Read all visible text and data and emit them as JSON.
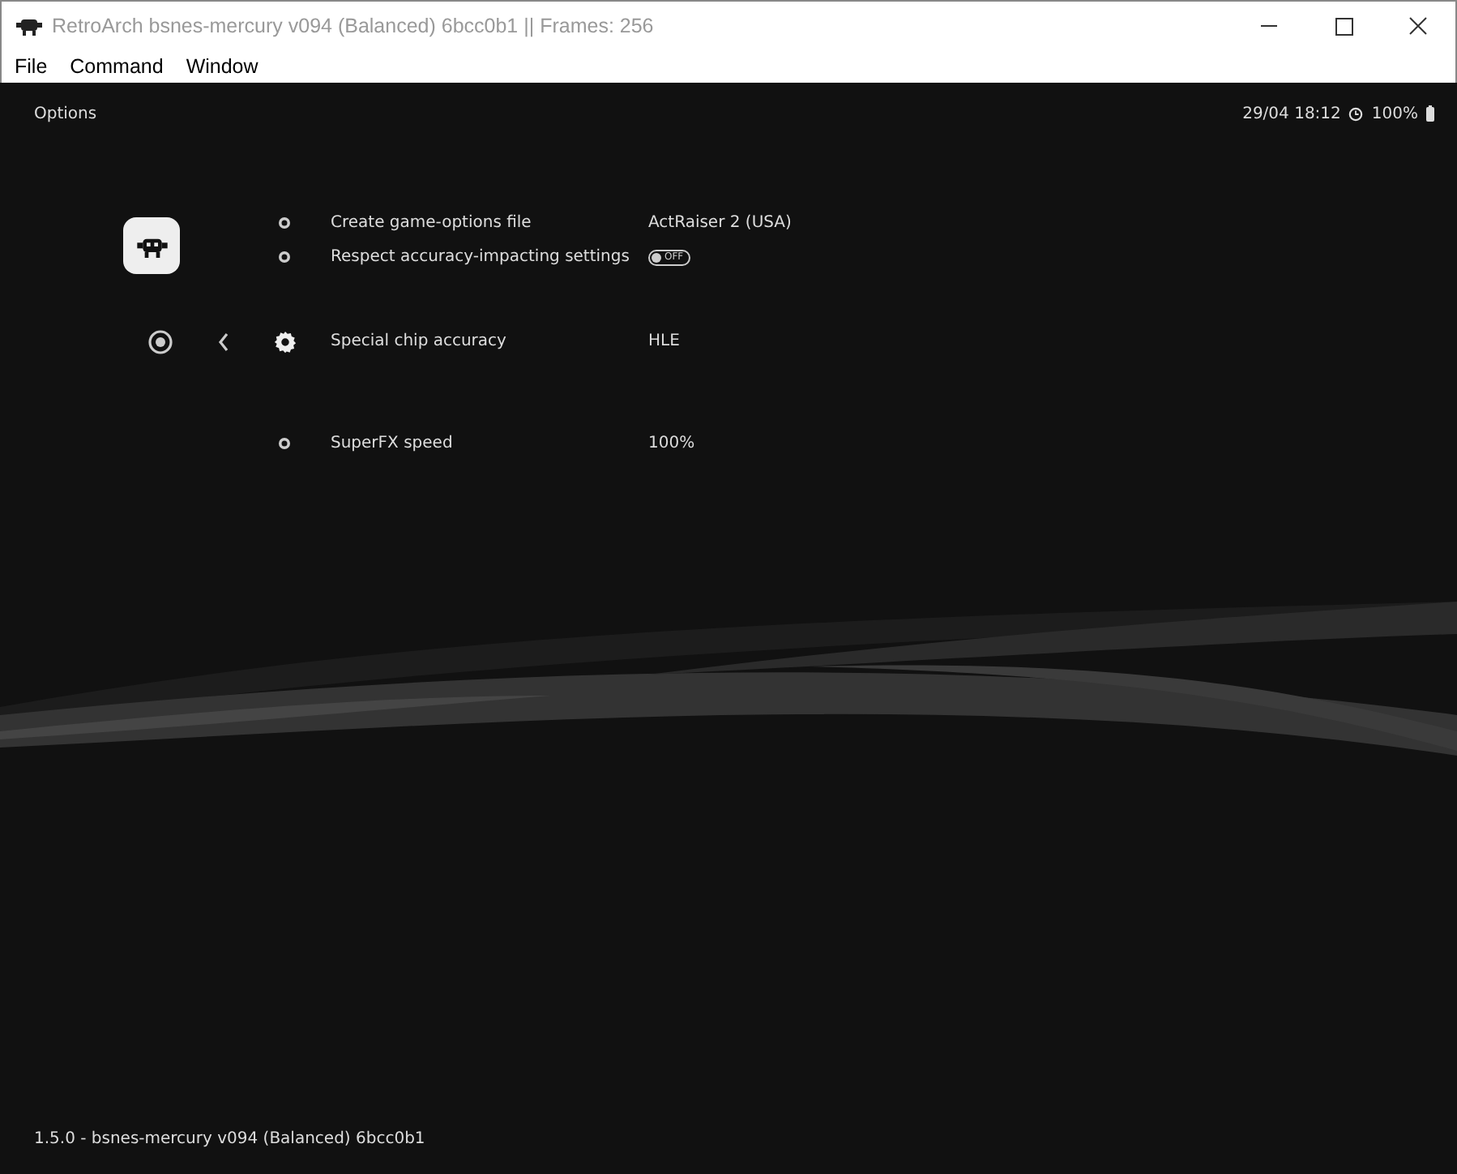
{
  "window": {
    "title": "RetroArch bsnes-mercury v094 (Balanced) 6bcc0b1 || Frames: 256"
  },
  "menu": [
    "File",
    "Command",
    "Window"
  ],
  "header": {
    "title": "Options",
    "clock": "29/04 18:12",
    "battery": "100%"
  },
  "items": [
    {
      "kind": "value",
      "label": "Create game-options file",
      "value": "ActRaiser 2 (USA)",
      "selected": false
    },
    {
      "kind": "toggle",
      "label": "Respect accuracy-impacting settings",
      "value": "OFF",
      "on": false,
      "selected": false
    },
    {
      "kind": "value",
      "label": "Special chip accuracy",
      "value": "HLE",
      "selected": true
    },
    {
      "kind": "value",
      "label": "SuperFX speed",
      "value": "100%",
      "selected": false
    }
  ],
  "footer": "1.5.0 - bsnes-mercury v094 (Balanced) 6bcc0b1"
}
